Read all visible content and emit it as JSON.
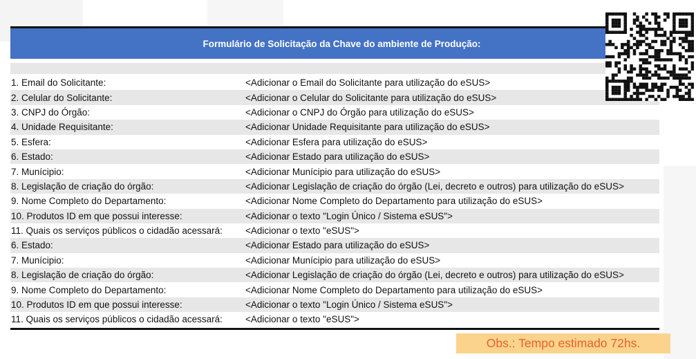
{
  "form": {
    "title": "Formulário de Solicitação da Chave do ambiente de Produção:",
    "rows": [
      {
        "label": "1. Email do Solicitante:",
        "value": "<Adicionar o Email do Solicitante para utilização do eSUS>"
      },
      {
        "label": "2. Celular do Solicitante:",
        "value": "<Adicionar o Celular do Solicitante para utilização do eSUS>"
      },
      {
        "label": "3. CNPJ do Órgão:",
        "value": "<Adicionar o CNPJ do Órgão para utilização do eSUS>"
      },
      {
        "label": "4. Unidade Requisitante:",
        "value": "<Adicionar Unidade Requisitante para utilização do eSUS>"
      },
      {
        "label": "5. Esfera:",
        "value": "<Adicionar Esfera para utilização do eSUS>"
      },
      {
        "label": "6. Estado:",
        "value": "<Adicionar Estado para utilização do eSUS>"
      },
      {
        "label": "7. Munícipio:",
        "value": "<Adicionar Munícipio para utilização do eSUS>"
      },
      {
        "label": "8. Legislação de criação do órgão:",
        "value": "<Adicionar Legislação de criação do órgão (Lei, decreto e outros) para utilização do eSUS>"
      },
      {
        "label": "9. Nome Completo do Departamento:",
        "value": "<Adicionar Nome Completo do Departamento para utilização do eSUS>"
      },
      {
        "label": "10. Produtos ID em que possui interesse:",
        "value": "<Adicionar o texto \"Login Único / Sistema eSUS\">"
      },
      {
        "label": "11. Quais os serviços públicos o cidadão acessará:",
        "value": "<Adicionar o texto \"eSUS\">"
      },
      {
        "label": "6. Estado:",
        "value": "<Adicionar Estado para utilização do eSUS>"
      },
      {
        "label": "7. Munícipio:",
        "value": "<Adicionar Munícipio para utilização do eSUS>"
      },
      {
        "label": "8. Legislação de criação do órgão:",
        "value": "<Adicionar Legislação de criação do órgão (Lei, decreto e outros) para utilização do eSUS>"
      },
      {
        "label": "9. Nome Completo do Departamento:",
        "value": "<Adicionar Nome Completo do Departamento para utilização do eSUS>"
      },
      {
        "label": "10. Produtos ID em que possui interesse:",
        "value": "<Adicionar o texto \"Login Único / Sistema eSUS\">"
      },
      {
        "label": "11. Quais os serviços públicos o cidadão acessará:",
        "value": "<Adicionar o texto \"eSUS\">"
      }
    ]
  },
  "note": "Obs.: Tempo estimado 72hs.",
  "qr_code": {
    "icon": "qr-code-icon"
  },
  "colors": {
    "header_bg": "#4472c4",
    "header_text": "#ffffff",
    "row_shade": "#e7e7e7",
    "note_bg": "#fbd38d",
    "note_text": "#e8622a"
  }
}
